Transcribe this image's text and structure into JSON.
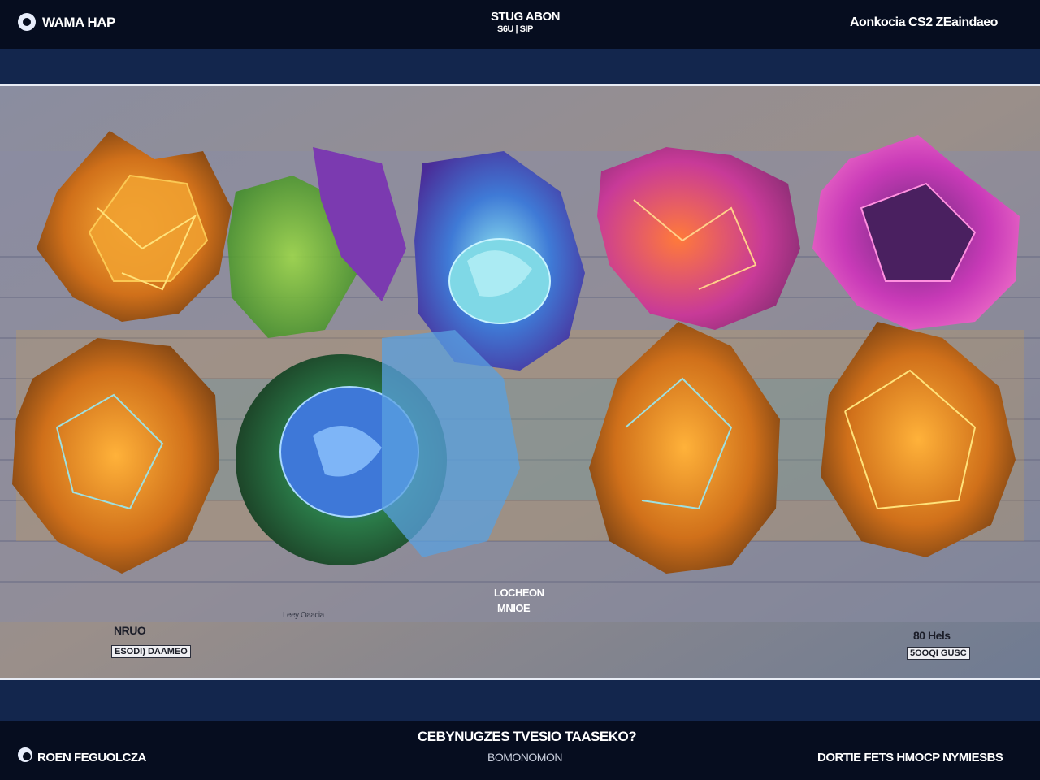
{
  "header": {
    "brand": "WAMA HAP",
    "center_line1": "STUG ABON",
    "center_line2": "S6U | SIP",
    "right": "Aonkocia CS2 ZEaindaeo"
  },
  "stage": {
    "center_line1": "LOCHEON",
    "center_line2": "MNIOE",
    "small_caption": "Leey Oaacia",
    "left_label": "NRUO",
    "left_chip": "ESODI) DAAMEO",
    "right_label": "80 Hels",
    "right_chip": "5OOQI GUSC"
  },
  "footer": {
    "left": "ROEN FEGUOLCZA",
    "center_line1": "CEBYNUGZES TVESIO TAASEKO?",
    "center_line2": "BOMONOMON",
    "right": "DORTIE FETS HMOCP NYMIESBS"
  },
  "colors": {
    "topbar": "#060d1f",
    "band": "#13264d",
    "stage": "#7c7f8c"
  }
}
